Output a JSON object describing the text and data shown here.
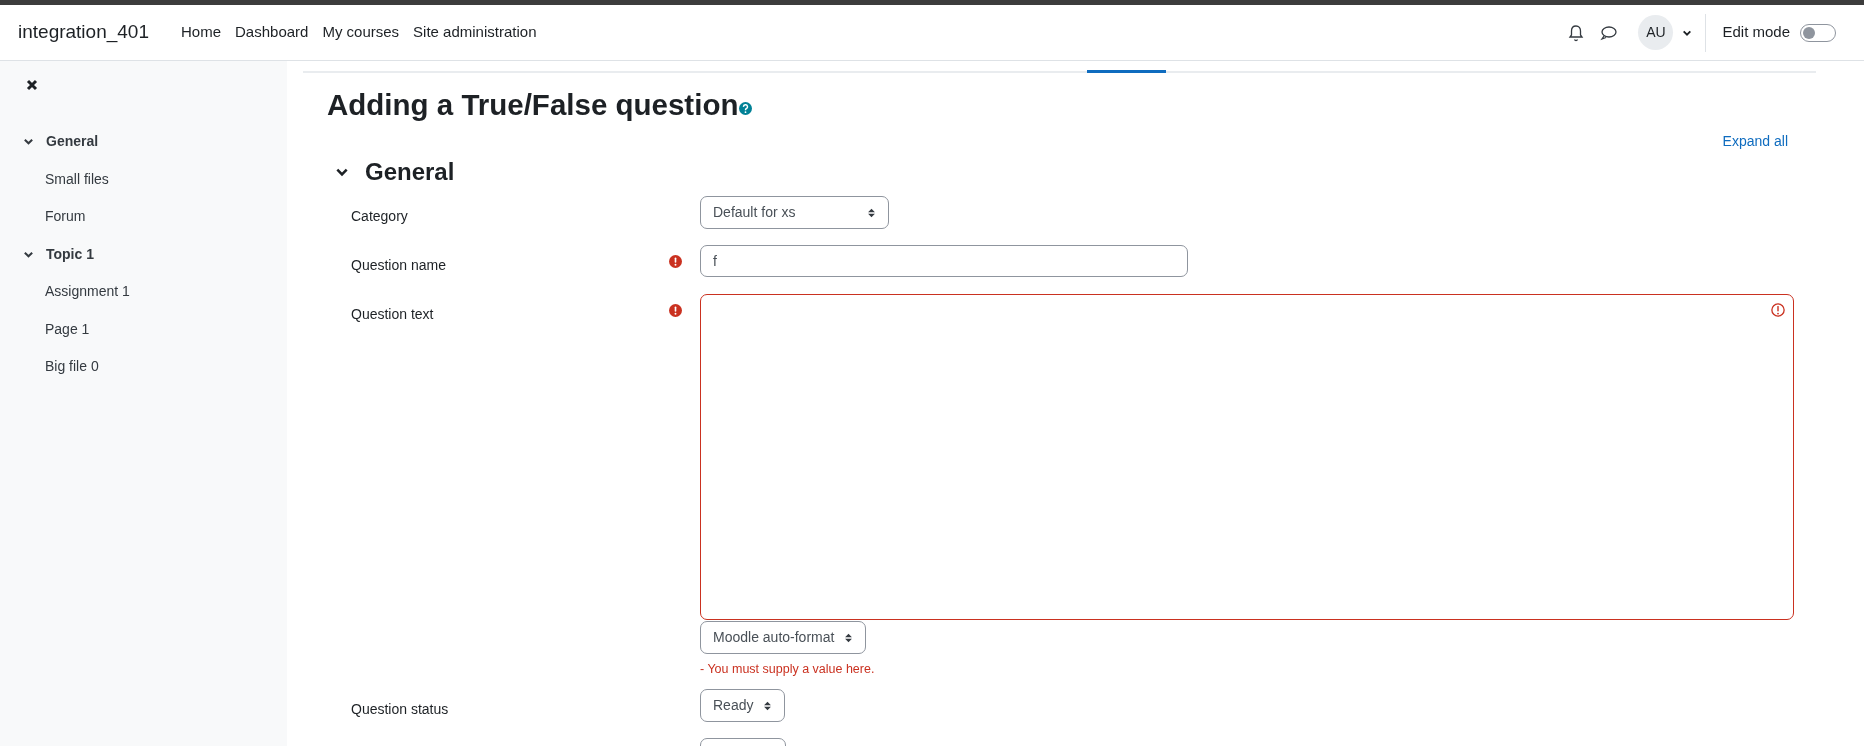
{
  "navbar": {
    "brand": "integration_401",
    "links": [
      "Home",
      "Dashboard",
      "My courses",
      "Site administration"
    ],
    "avatar": "AU",
    "edit_mode": {
      "label": "Edit mode",
      "on": false
    }
  },
  "sidebar": {
    "sections": [
      {
        "title": "General",
        "expanded": true,
        "children": [
          {
            "label": "Small files"
          },
          {
            "label": "Forum"
          }
        ]
      },
      {
        "title": "Topic 1",
        "expanded": true,
        "children": [
          {
            "label": "Assignment 1"
          },
          {
            "label": "Page 1"
          },
          {
            "label": "Big file 0"
          }
        ]
      }
    ]
  },
  "page": {
    "title": "Adding a True/False question",
    "expand_all": "Expand all",
    "section": {
      "title": "General",
      "expanded": true
    },
    "fields": [
      {
        "kind": "select",
        "label": "Category",
        "value": "Default for xs",
        "required": false
      },
      {
        "kind": "text",
        "label": "Question name",
        "value": "f",
        "required": true
      },
      {
        "kind": "editor",
        "label": "Question text",
        "required": true,
        "invalid": true,
        "format": "Moodle auto-format",
        "error": "- You must supply a value here."
      },
      {
        "kind": "select",
        "label": "Question status",
        "value": "Ready",
        "required": false
      },
      {
        "kind": "select",
        "required": false
      }
    ]
  }
}
